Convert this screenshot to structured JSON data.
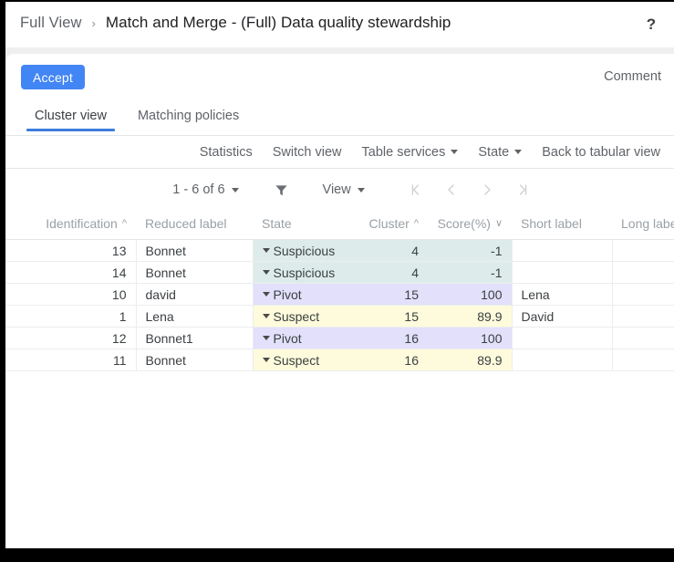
{
  "window": {
    "help_icon": "question-mark-icon"
  },
  "breadcrumb": {
    "root": "Full View",
    "separator": "›",
    "current": "Match and Merge - (Full) Data quality stewardship"
  },
  "actions": {
    "accept_label": "Accept",
    "comment_label": "Comment",
    "accept_color": "#4285f4"
  },
  "tabs": [
    {
      "label": "Cluster view",
      "active": true
    },
    {
      "label": "Matching policies",
      "active": false
    }
  ],
  "services_toolbar": [
    {
      "label": "Statistics",
      "has_caret": false
    },
    {
      "label": "Switch view",
      "has_caret": false
    },
    {
      "label": "Table services",
      "has_caret": true
    },
    {
      "label": "State",
      "has_caret": true
    },
    {
      "label": "Back to tabular view",
      "has_caret": false
    }
  ],
  "pager": {
    "range_label": "1 - 6 of 6",
    "filter_icon": "funnel-icon",
    "view_label": "View",
    "nav": {
      "first": "first-page-icon",
      "prev": "previous-page-icon",
      "next": "next-page-icon",
      "last": "last-page-icon"
    }
  },
  "table": {
    "columns": [
      {
        "key": "identification",
        "label": "Identification",
        "sort": "asc",
        "align": "right"
      },
      {
        "key": "reduced_label",
        "label": "Reduced label",
        "sort": null,
        "align": "left"
      },
      {
        "key": "state",
        "label": "State",
        "sort": null,
        "align": "left"
      },
      {
        "key": "cluster",
        "label": "Cluster",
        "sort": "asc",
        "align": "right"
      },
      {
        "key": "score",
        "label": "Score(%)",
        "sort": "desc",
        "align": "right"
      },
      {
        "key": "short_label",
        "label": "Short label",
        "sort": null,
        "align": "left"
      },
      {
        "key": "long_label",
        "label": "Long label",
        "sort": null,
        "align": "left"
      }
    ],
    "state_colors": {
      "Suspicious": "#ddecea",
      "Pivot": "#e2e0fa",
      "Suspect": "#fdfbdc"
    },
    "rows": [
      {
        "identification": "13",
        "reduced_label": "Bonnet",
        "state": "Suspicious",
        "cluster": "4",
        "score": "-1",
        "short_label": "",
        "long_label": ""
      },
      {
        "identification": "14",
        "reduced_label": "Bonnet",
        "state": "Suspicious",
        "cluster": "4",
        "score": "-1",
        "short_label": "",
        "long_label": ""
      },
      {
        "identification": "10",
        "reduced_label": "david",
        "state": "Pivot",
        "cluster": "15",
        "score": "100",
        "short_label": "Lena",
        "long_label": ""
      },
      {
        "identification": "1",
        "reduced_label": "Lena",
        "state": "Suspect",
        "cluster": "15",
        "score": "89.9",
        "short_label": "David",
        "long_label": ""
      },
      {
        "identification": "12",
        "reduced_label": "Bonnet1",
        "state": "Pivot",
        "cluster": "16",
        "score": "100",
        "short_label": "",
        "long_label": ""
      },
      {
        "identification": "11",
        "reduced_label": "Bonnet",
        "state": "Suspect",
        "cluster": "16",
        "score": "89.9",
        "short_label": "",
        "long_label": ""
      }
    ]
  }
}
